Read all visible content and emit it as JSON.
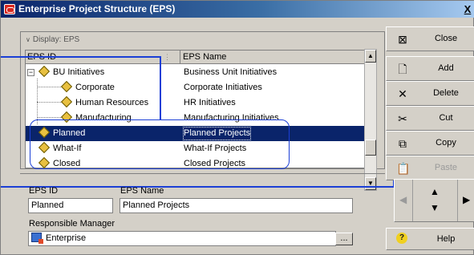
{
  "window": {
    "title": "Enterprise Project Structure (EPS)",
    "close_glyph": "X"
  },
  "display_bar": {
    "label": "Display: EPS"
  },
  "grid": {
    "columns": [
      "EPS ID",
      "EPS Name"
    ],
    "rows": [
      {
        "id": "BU Initiatives",
        "name": "Business Unit Initiatives",
        "level": 0,
        "expanded": true,
        "selected": false
      },
      {
        "id": "Corporate",
        "name": "Corporate Initiatives",
        "level": 1,
        "selected": false
      },
      {
        "id": "Human Resources",
        "name": "HR Initiatives",
        "level": 1,
        "selected": false
      },
      {
        "id": "Manufacturing",
        "name": "Manufacturing Initiatives",
        "level": 1,
        "selected": false
      },
      {
        "id": "Planned",
        "name": "Planned Projects",
        "level": 0,
        "selected": true
      },
      {
        "id": "What-If",
        "name": "What-If Projects",
        "level": 0,
        "selected": false
      },
      {
        "id": "Closed",
        "name": "Closed Projects",
        "level": 0,
        "selected": false
      }
    ]
  },
  "buttons": {
    "close": {
      "label": "Close",
      "icon": "close-window-icon"
    },
    "add": {
      "label": "Add",
      "icon": "new-document-icon"
    },
    "delete": {
      "label": "Delete",
      "icon": "delete-x-icon"
    },
    "cut": {
      "label": "Cut",
      "icon": "scissors-icon"
    },
    "copy": {
      "label": "Copy",
      "icon": "copy-icon"
    },
    "paste": {
      "label": "Paste",
      "icon": "paste-icon",
      "disabled": true
    },
    "help": {
      "label": "Help",
      "icon": "help-icon"
    }
  },
  "form": {
    "eps_id_label": "EPS ID",
    "eps_id_value": "Planned",
    "eps_name_label": "EPS Name",
    "eps_name_value": "Planned Projects",
    "manager_label": "Responsible Manager",
    "manager_value": "Enterprise",
    "ellipsis": "..."
  },
  "colors": {
    "selection": "#0a246a",
    "callout": "#1b3fd6",
    "dialog_bg": "#d4d0c8"
  }
}
